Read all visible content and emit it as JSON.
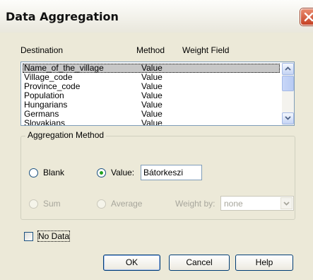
{
  "window": {
    "title": "Data Aggregation"
  },
  "columns": {
    "destination": "Destination",
    "method": "Method",
    "weight_field": "Weight Field"
  },
  "rows": [
    {
      "destination": "Name_of_the_village",
      "method": "Value",
      "selected": true
    },
    {
      "destination": "Village_code",
      "method": "Value"
    },
    {
      "destination": "Province_code",
      "method": "Value"
    },
    {
      "destination": "Population",
      "method": "Value"
    },
    {
      "destination": "Hungarians",
      "method": "Value"
    },
    {
      "destination": "Germans",
      "method": "Value"
    },
    {
      "destination": "Slovakians",
      "method": "Value"
    }
  ],
  "aggregation": {
    "legend": "Aggregation Method",
    "blank_label": "Blank",
    "value_label": "Value:",
    "value_text": "Bátorkeszi",
    "sum_label": "Sum",
    "average_label": "Average",
    "weight_by_label": "Weight by:",
    "weight_by_value": "none",
    "selected": "value"
  },
  "no_data": {
    "label": "No Data",
    "checked": false
  },
  "buttons": {
    "ok": "OK",
    "cancel": "Cancel",
    "help": "Help"
  },
  "colors": {
    "selection": "#c7c7c7",
    "radio_dot": "#21a121",
    "close_button": "#c54124"
  }
}
